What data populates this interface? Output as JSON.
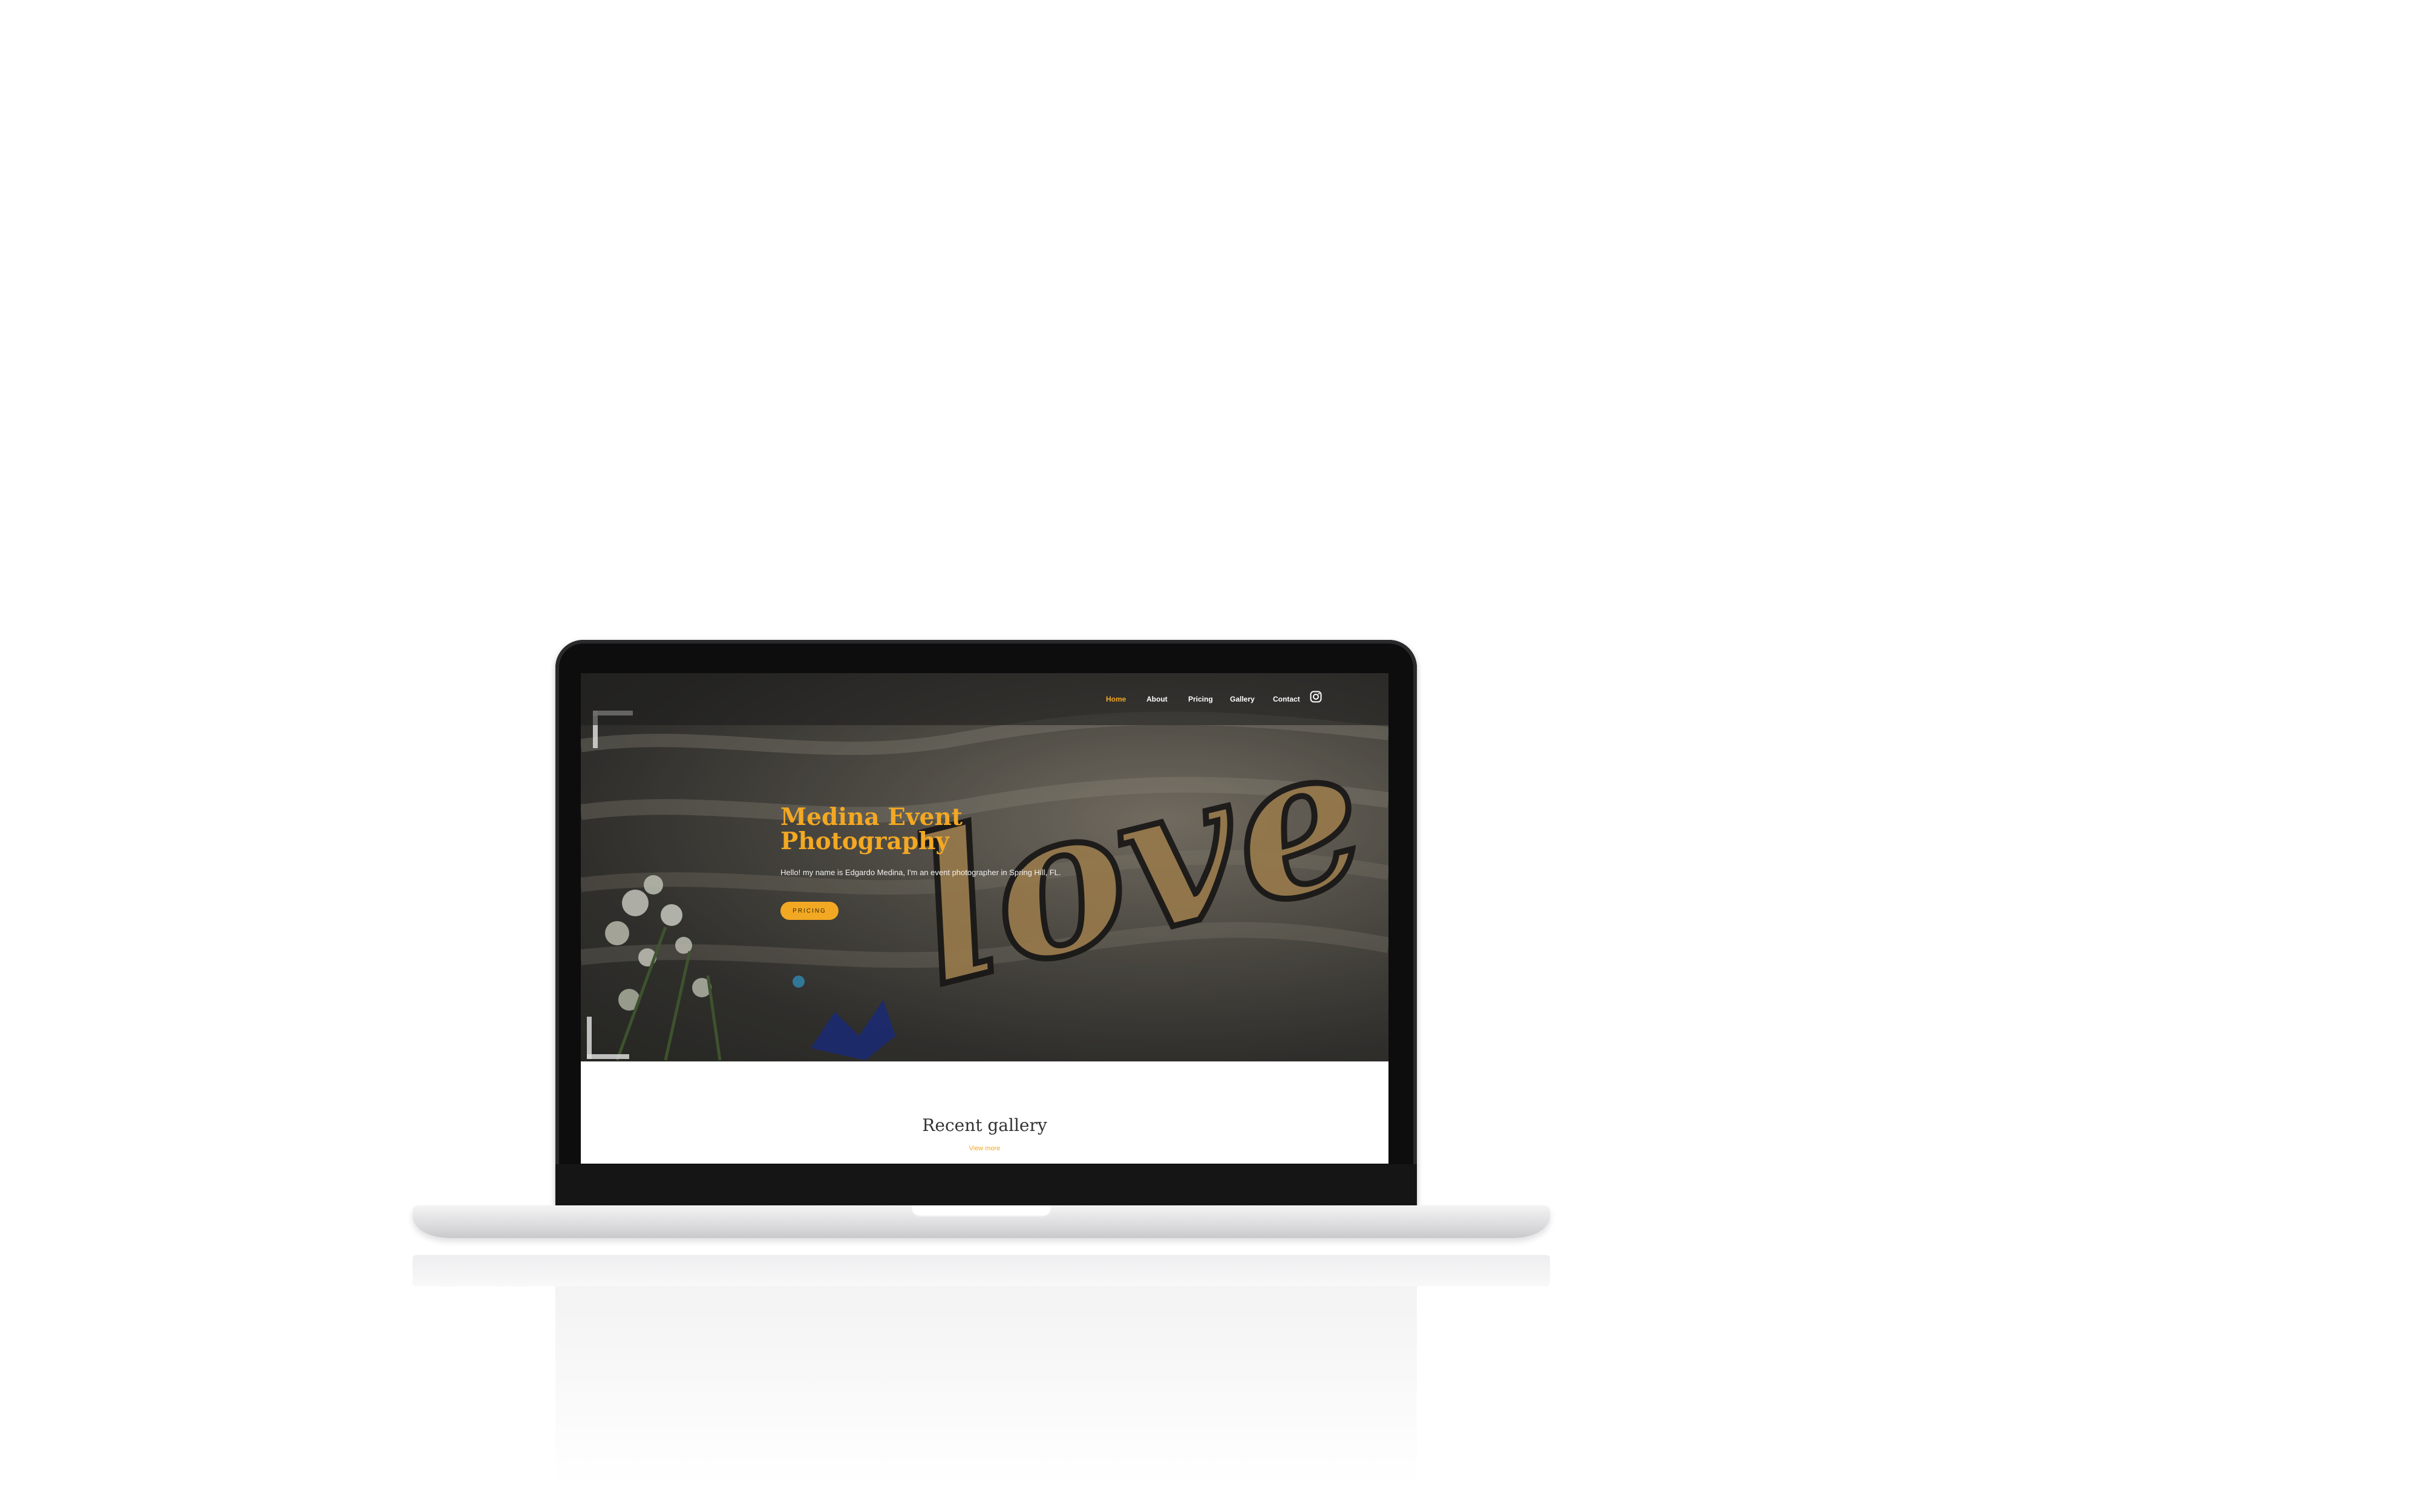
{
  "site": {
    "nav": {
      "items": [
        {
          "label": "Home",
          "active": true
        },
        {
          "label": "About",
          "active": false
        },
        {
          "label": "Pricing",
          "active": false
        },
        {
          "label": "Gallery",
          "active": false
        },
        {
          "label": "Contact",
          "active": false
        }
      ],
      "social_icon": "instagram-icon"
    },
    "hero": {
      "title": "Medina Event Photography",
      "text": "Hello! my name is Edgardo Medina, I'm an event photographer in Spring Hill, FL.",
      "button_label": "PRICING",
      "decor_text": "love"
    },
    "gallery": {
      "title": "Recent gallery",
      "link_label": "View more"
    }
  },
  "colors": {
    "accent": "#f3a823",
    "nav_text": "#ffffff",
    "heading_dark": "#333333"
  }
}
